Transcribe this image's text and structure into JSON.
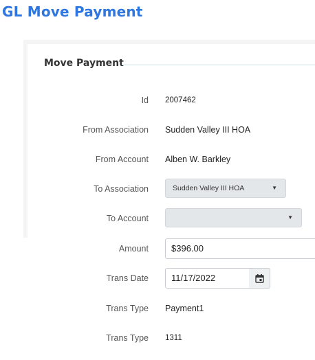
{
  "page": {
    "title": "GL Move Payment"
  },
  "section": {
    "title": "Move Payment"
  },
  "form": {
    "id": {
      "label": "Id",
      "value": "2007462"
    },
    "from_association": {
      "label": "From Association",
      "value": "Sudden Valley III HOA"
    },
    "from_account": {
      "label": "From Account",
      "value": "Alben W. Barkley"
    },
    "to_association": {
      "label": "To Association",
      "value": "Sudden Valley III HOA"
    },
    "to_account": {
      "label": "To Account",
      "value": ""
    },
    "amount": {
      "label": "Amount",
      "value": "$396.00"
    },
    "trans_date": {
      "label": "Trans Date",
      "value": "11/17/2022"
    },
    "trans_type_1": {
      "label": "Trans Type",
      "value": "Payment1"
    },
    "trans_type_2": {
      "label": "Trans Type",
      "value": "1311"
    }
  },
  "icons": {
    "select_caret": "caret-down-icon",
    "calendar": "calendar-icon"
  }
}
